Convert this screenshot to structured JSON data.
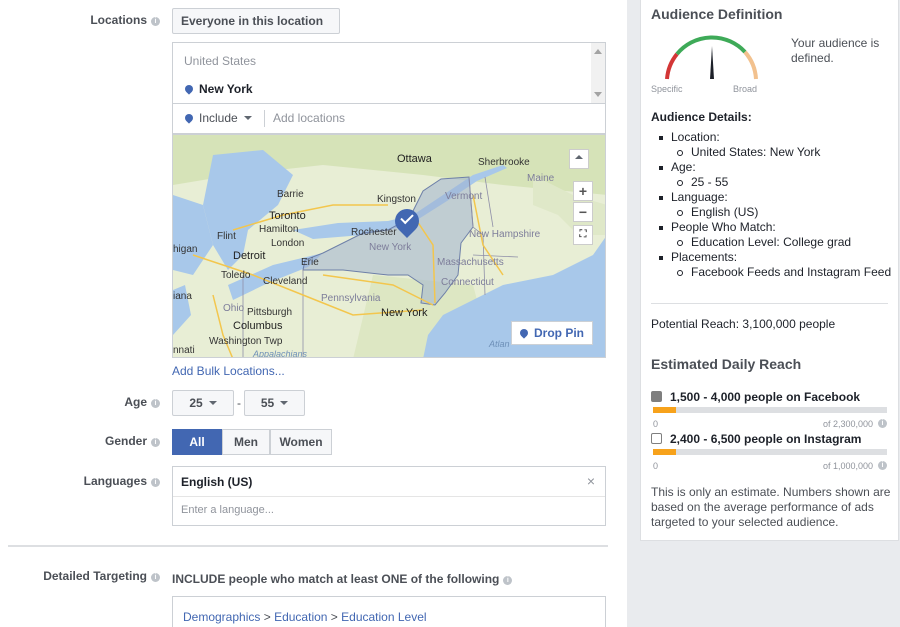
{
  "locations": {
    "label": "Locations",
    "type_dropdown": "Everyone in this location",
    "country": "United States",
    "city": "New York",
    "include_label": "Include",
    "add_placeholder": "Add locations",
    "bulk_link": "Add Bulk Locations..."
  },
  "map": {
    "drop_pin": "Drop Pin",
    "zoom_in": "+",
    "zoom_out": "−",
    "labels": {
      "ottawa": "Ottawa",
      "sherbrooke": "Sherbrooke",
      "maine": "Maine",
      "barrie": "Barrie",
      "kingston": "Kingston",
      "vermont": "Vermont",
      "toronto": "Toronto",
      "hamilton": "Hamilton",
      "london": "London",
      "rochester": "Rochester",
      "new_york_state": "New York",
      "new_hampshire": "New Hampshire",
      "flint": "Flint",
      "detroit": "Detroit",
      "erie": "Erie",
      "massachusetts": "Massachusetts",
      "toledo": "Toledo",
      "cleveland": "Cleveland",
      "connecticut": "Connecticut",
      "ohio": "Ohio",
      "pittsburgh": "Pittsburgh",
      "pennsylvania": "Pennsylvania",
      "new_york_city": "New York",
      "columbus": "Columbus",
      "washington_twp": "Washington Twp",
      "appalachians": "Appalachians",
      "atlantic": "Atlan",
      "cinnati": "nnati",
      "iana": "iana",
      "higan": "higan"
    }
  },
  "age": {
    "label": "Age",
    "min": "25",
    "separator": "-",
    "max": "55"
  },
  "gender": {
    "label": "Gender",
    "options": [
      "All",
      "Men",
      "Women"
    ],
    "selected": "All"
  },
  "languages": {
    "label": "Languages",
    "value": "English (US)",
    "remove": "×",
    "placeholder": "Enter a language..."
  },
  "detailed_targeting": {
    "label": "Detailed Targeting",
    "instruction": "INCLUDE people who match at least ONE of the following",
    "crumb_1": "Demographics",
    "crumb_sep": ">",
    "crumb_2": "Education",
    "crumb_3": "Education Level"
  },
  "audience": {
    "title": "Audience Definition",
    "gauge_left": "Specific",
    "gauge_right": "Broad",
    "status": "Your audience is defined.",
    "details_title": "Audience Details:",
    "details": [
      {
        "text": "Location:",
        "level": 1
      },
      {
        "text": "United States: New York",
        "level": 2
      },
      {
        "text": "Age:",
        "level": 1
      },
      {
        "text": "25 - 55",
        "level": 2
      },
      {
        "text": "Language:",
        "level": 1
      },
      {
        "text": "English (US)",
        "level": 2
      },
      {
        "text": "People Who Match:",
        "level": 1
      },
      {
        "text": "Education Level: College grad",
        "level": 2
      },
      {
        "text": "Placements:",
        "level": 1
      },
      {
        "text": "Facebook Feeds and Instagram Feed",
        "level": 2
      }
    ],
    "potential_reach": "Potential Reach: 3,100,000 people"
  },
  "daily_reach": {
    "title": "Estimated Daily Reach",
    "facebook": {
      "text": "1,500 - 4,000 people on Facebook",
      "min": "0",
      "max": "of 2,300,000",
      "fill_fraction": 0.1
    },
    "instagram": {
      "text": "2,400 - 6,500 people on Instagram",
      "min": "0",
      "max": "of 1,000,000",
      "fill_fraction": 0.1
    },
    "note": "This is only an estimate. Numbers shown are based on the average performance of ads targeted to your selected audience."
  },
  "colors": {
    "accent": "#4267b2",
    "bar_fill": "#f7a21b",
    "gauge_green": "#3eaa58",
    "gauge_red": "#d33636",
    "gauge_yellow": "#f2c18e"
  }
}
